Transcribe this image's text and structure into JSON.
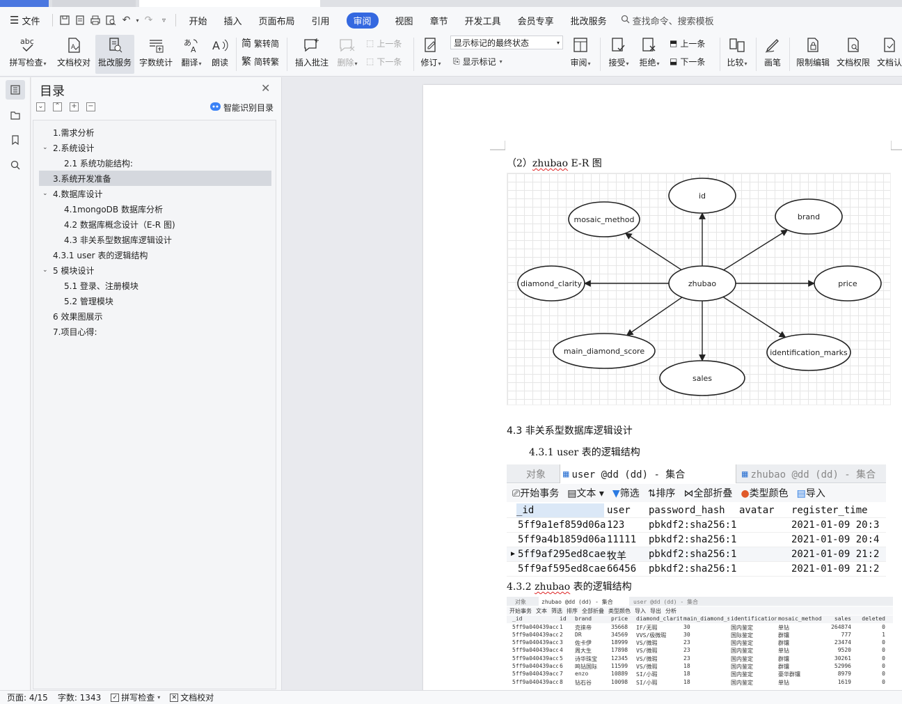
{
  "menubar": {
    "file_label": "文件",
    "tabs": [
      "开始",
      "插入",
      "页面布局",
      "引用",
      "审阅",
      "视图",
      "章节",
      "开发工具",
      "会员专享",
      "批改服务"
    ],
    "active_tab": "审阅",
    "search_label": "查找命令、搜索模板"
  },
  "ribbon": {
    "spell_check": "拼写检查",
    "doc_proof": "文档校对",
    "correct_service": "批改服务",
    "word_count": "字数统计",
    "translate": "翻译",
    "read_aloud": "朗读",
    "trad_to_simp": "繁转简",
    "simp_to_trad": "简转繁",
    "insert_comment": "插入批注",
    "delete": "删除",
    "prev_comment": "上一条",
    "next_comment": "下一条",
    "track_changes": "修订",
    "markup_select": "显示标记的最终状态",
    "show_markup": "显示标记",
    "review": "审阅",
    "accept": "接受",
    "reject": "拒绝",
    "prev_change": "上一条",
    "next_change": "下一条",
    "compare": "比较",
    "ink": "画笔",
    "restrict_edit": "限制编辑",
    "doc_permission": "文档权限",
    "doc_cert": "文档认"
  },
  "toc": {
    "title": "目录",
    "smart_label": "智能识别目录",
    "items": [
      {
        "label": "1.需求分析"
      },
      {
        "label": "2.系统设计"
      },
      {
        "label": "2.1 系统功能结构:"
      },
      {
        "label": "3.系统开发准备"
      },
      {
        "label": "4.数据库设计"
      },
      {
        "label": "4.1mongoDB 数据库分析"
      },
      {
        "label": "4.2 数据库概念设计（E-R 图)"
      },
      {
        "label": "4.3 非关系型数据库逻辑设计"
      },
      {
        "label": "4.3.1 user 表的逻辑结构"
      },
      {
        "label": "5 模块设计"
      },
      {
        "label": "5.1 登录、注册模块"
      },
      {
        "label": "5.2 管理模块"
      },
      {
        "label": "6 效果图展示"
      },
      {
        "label": "7.项目心得:"
      }
    ]
  },
  "doc": {
    "er_caption_prefix": "（2）",
    "er_caption_word": "zhubao",
    "er_caption_suffix": " E-R 图",
    "er": {
      "center": "zhubao",
      "nodes": [
        "id",
        "brand",
        "price",
        "identification_marks",
        "sales",
        "main_diamond_score",
        "diamond_clarity",
        "mosaic_method"
      ]
    },
    "h43": "4.3 非关系型数据库逻辑设计",
    "h431": "4.3.1 user 表的逻辑结构",
    "h432_prefix": "4.3.2 ",
    "h432_word": "zhubao",
    "h432_suffix": " 表的逻辑结构"
  },
  "user_shot": {
    "tab_obj": "对象",
    "tab_user": "user @dd (dd) - 集合",
    "tab_zhubao": "zhubao @dd (dd) - 集合",
    "toolbar": [
      "开始事务",
      "文本",
      "筛选",
      "排序",
      "全部折叠",
      "类型颜色",
      "导入"
    ],
    "headers": [
      "_id",
      "user",
      "password_hash",
      "avatar",
      "register_time"
    ],
    "rows": [
      [
        "5ff9a1ef859d06a",
        "123",
        "pbkdf2:sha256:1",
        "",
        "2021-01-09 20:3"
      ],
      [
        "5ff9a4b1859d06a",
        "11111",
        "pbkdf2:sha256:1",
        "",
        "2021-01-09 20:4"
      ],
      [
        "5ff9af295ed8cae",
        "牧羊",
        "pbkdf2:sha256:1",
        "",
        "2021-01-09 21:2"
      ],
      [
        "5ff9af595ed8cae",
        "66456",
        "pbkdf2:sha256:1",
        "",
        "2021-01-09 21:2"
      ]
    ]
  },
  "zhubao_shot": {
    "tab_obj": "对象",
    "tab_zhubao": "zhubao @dd (dd) - 集合",
    "tab_user": "user @dd (dd) - 集合",
    "toolbar": [
      "开始事务",
      "文本",
      "筛选",
      "排序",
      "全部折叠",
      "类型颜色",
      "导入",
      "导出",
      "分析"
    ],
    "headers": [
      "_id",
      "id",
      "brand",
      "price",
      "diamond_clarity",
      "main_diamond_sc",
      "identification_",
      "mosaic_method",
      "sales",
      "deleted"
    ],
    "rows": [
      [
        "5ff9a040439acd0",
        "1",
        "克徕帝",
        "35668",
        "IF/无瑕",
        "30",
        "国内鉴定",
        "单钻",
        "264874",
        "0"
      ],
      [
        "5ff9a040439acd0",
        "2",
        "DR",
        "34569",
        "VVS/极微瑕",
        "30",
        "国际鉴定",
        "群镶",
        "777",
        "1"
      ],
      [
        "5ff9a040439acd0",
        "3",
        "佐卡伊",
        "18999",
        "VS/微瑕",
        "23",
        "国内鉴定",
        "群镶",
        "23474",
        "0"
      ],
      [
        "5ff9a040439acd0",
        "4",
        "周大生",
        "17898",
        "VS/微瑕",
        "23",
        "国内鉴定",
        "单钻",
        "9520",
        "0"
      ],
      [
        "5ff9a040439acd0",
        "5",
        "诗华珠宝",
        "12345",
        "VS/微瑕",
        "23",
        "国内鉴定",
        "群镶",
        "30261",
        "0"
      ],
      [
        "5ff9a040439acd0",
        "6",
        "鸣钻国际",
        "11599",
        "VS/微瑕",
        "18",
        "国内鉴定",
        "群镶",
        "52996",
        "0"
      ],
      [
        "5ff9a040439acd0",
        "7",
        "enzo",
        "10889",
        "SI/小瑕",
        "18",
        "国内鉴定",
        "豪华群镶",
        "8979",
        "0"
      ],
      [
        "5ff9a040439acd0",
        "8",
        "钻石谷",
        "10098",
        "SI/小瑕",
        "18",
        "国内鉴定",
        "单钻",
        "1619",
        "0"
      ]
    ]
  },
  "status": {
    "page": "页面: 4/15",
    "words": "字数: 1343",
    "spell": "拼写检查",
    "proof": "文档校对"
  }
}
